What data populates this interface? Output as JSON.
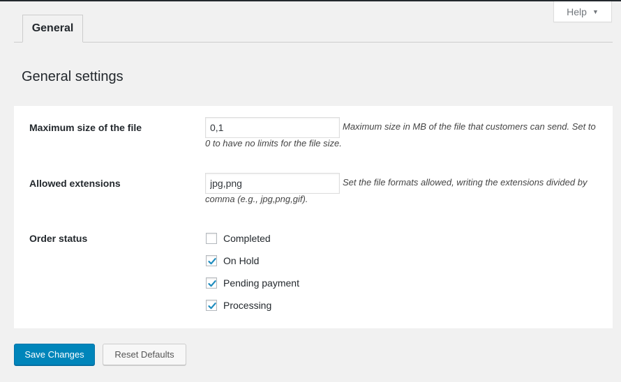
{
  "help": {
    "label": "Help",
    "caret": "▼"
  },
  "tabs": [
    {
      "label": "General",
      "active": true
    }
  ],
  "section_title": "General settings",
  "fields": {
    "max_size": {
      "label": "Maximum size of the file",
      "value": "0,1",
      "description": "Maximum size in MB of the file that customers can send. Set to 0 to have no limits for the file size."
    },
    "extensions": {
      "label": "Allowed extensions",
      "value": "jpg,png",
      "description": "Set the file formats allowed, writing the extensions divided by comma (e.g., jpg,png,gif)."
    },
    "order_status": {
      "label": "Order status",
      "options": [
        {
          "label": "Completed",
          "checked": false
        },
        {
          "label": "On Hold",
          "checked": true
        },
        {
          "label": "Pending payment",
          "checked": true
        },
        {
          "label": "Processing",
          "checked": true
        }
      ]
    }
  },
  "buttons": {
    "save": "Save Changes",
    "reset": "Reset Defaults"
  },
  "colors": {
    "primary": "#0085ba",
    "check": "#1e8cbe",
    "background": "#f1f1f1"
  }
}
